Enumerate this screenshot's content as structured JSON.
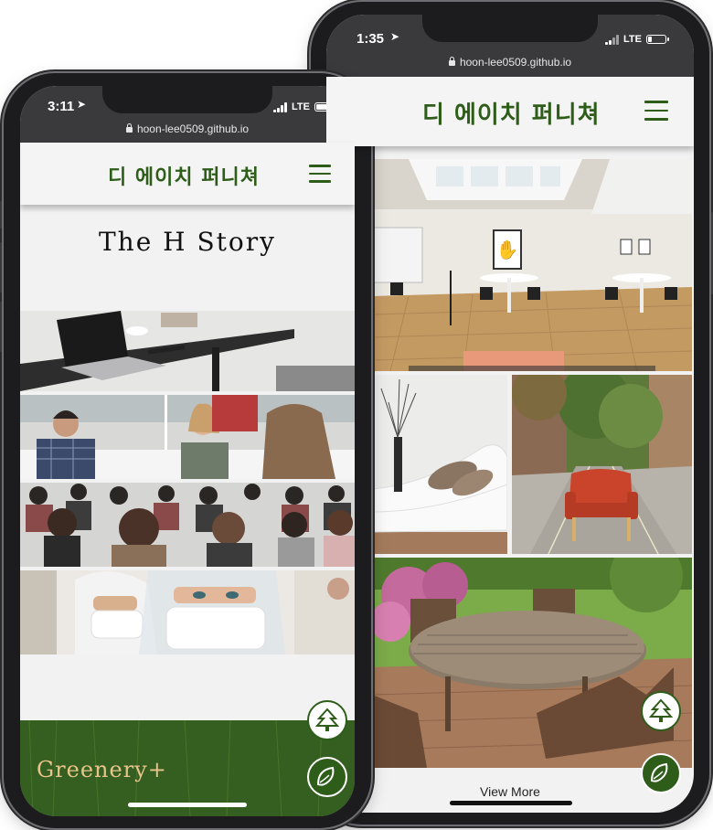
{
  "back_phone": {
    "status_time": "1:35",
    "network": "LTE",
    "url": "hoon-lee0509.github.io",
    "brand": "디 에이치 퍼니쳐",
    "view_more": "View More",
    "photos": [
      "office-lounge",
      "white-sofa",
      "red-armchair-street",
      "garden-table"
    ]
  },
  "front_phone": {
    "status_time": "3:11",
    "network": "LTE",
    "url": "hoon-lee0509.github.io",
    "brand": "디 에이치 퍼니쳐",
    "story_title": "The H Story",
    "greenery": "Greenery+",
    "photos": [
      "laptop-desk",
      "meeting",
      "seminar",
      "lab-workers"
    ]
  },
  "colors": {
    "brand": "#2e5d1a",
    "header_bg": "#f4f4f4",
    "bar": "#3a3a3c",
    "greenery_text": "#e8c48a"
  }
}
